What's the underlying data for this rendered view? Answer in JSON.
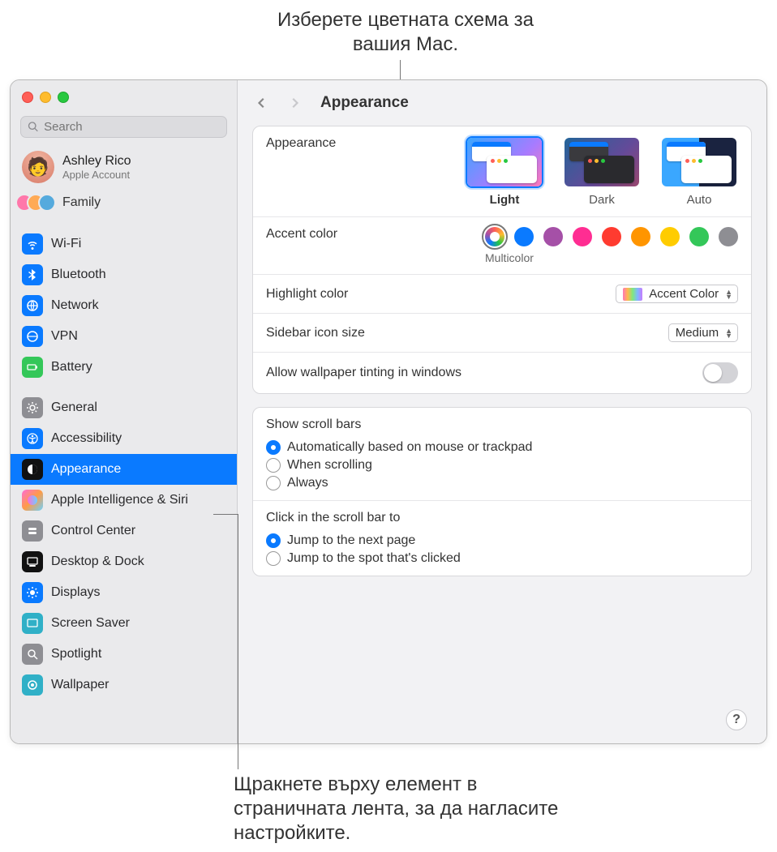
{
  "callouts": {
    "top": "Изберете цветната схема за вашия Mac.",
    "bottom": "Щракнете върху елемент в страничната лента, за да нагласите настройките."
  },
  "search": {
    "placeholder": "Search"
  },
  "account": {
    "name": "Ashley Rico",
    "sub": "Apple Account"
  },
  "family": {
    "label": "Family"
  },
  "sidebar": {
    "group1": [
      {
        "id": "wifi",
        "label": "Wi-Fi",
        "color": "#0a7aff"
      },
      {
        "id": "bluetooth",
        "label": "Bluetooth",
        "color": "#0a7aff"
      },
      {
        "id": "network",
        "label": "Network",
        "color": "#0a7aff"
      },
      {
        "id": "vpn",
        "label": "VPN",
        "color": "#0a7aff"
      },
      {
        "id": "battery",
        "label": "Battery",
        "color": "#34c759"
      }
    ],
    "group2": [
      {
        "id": "general",
        "label": "General",
        "color": "#8e8e93"
      },
      {
        "id": "accessibility",
        "label": "Accessibility",
        "color": "#0a7aff"
      },
      {
        "id": "appearance",
        "label": "Appearance",
        "color": "#111"
      },
      {
        "id": "siri",
        "label": "Apple Intelligence & Siri",
        "color": "linear"
      },
      {
        "id": "controlcenter",
        "label": "Control Center",
        "color": "#8e8e93"
      },
      {
        "id": "desktop",
        "label": "Desktop & Dock",
        "color": "#111"
      },
      {
        "id": "displays",
        "label": "Displays",
        "color": "#0a7aff"
      },
      {
        "id": "screensaver",
        "label": "Screen Saver",
        "color": "#30b0c7"
      },
      {
        "id": "spotlight",
        "label": "Spotlight",
        "color": "#8e8e93"
      },
      {
        "id": "wallpaper",
        "label": "Wallpaper",
        "color": "#30b0c7"
      }
    ],
    "selected": "appearance"
  },
  "page": {
    "title": "Appearance"
  },
  "appearance": {
    "label": "Appearance",
    "options": [
      {
        "id": "light",
        "label": "Light"
      },
      {
        "id": "dark",
        "label": "Dark"
      },
      {
        "id": "auto",
        "label": "Auto"
      }
    ],
    "selected": "light"
  },
  "accent": {
    "label": "Accent color",
    "selected_label": "Multicolor",
    "colors": [
      {
        "id": "multi",
        "value": "multi"
      },
      {
        "id": "blue",
        "value": "#0a7aff"
      },
      {
        "id": "purple",
        "value": "#a550a7"
      },
      {
        "id": "pink",
        "value": "#ff2d92"
      },
      {
        "id": "red",
        "value": "#ff3b30"
      },
      {
        "id": "orange",
        "value": "#ff9500"
      },
      {
        "id": "yellow",
        "value": "#ffcc00"
      },
      {
        "id": "green",
        "value": "#34c759"
      },
      {
        "id": "graphite",
        "value": "#8e8e93"
      }
    ],
    "selected": "multi"
  },
  "highlight": {
    "label": "Highlight color",
    "value": "Accent Color"
  },
  "sidebar_size": {
    "label": "Sidebar icon size",
    "value": "Medium"
  },
  "tinting": {
    "label": "Allow wallpaper tinting in windows",
    "on": false
  },
  "scrollbars": {
    "title": "Show scroll bars",
    "options": [
      {
        "id": "auto",
        "label": "Automatically based on mouse or trackpad"
      },
      {
        "id": "scrolling",
        "label": "When scrolling"
      },
      {
        "id": "always",
        "label": "Always"
      }
    ],
    "selected": "auto"
  },
  "click_scroll": {
    "title": "Click in the scroll bar to",
    "options": [
      {
        "id": "next",
        "label": "Jump to the next page"
      },
      {
        "id": "spot",
        "label": "Jump to the spot that's clicked"
      }
    ],
    "selected": "next"
  },
  "help": "?"
}
